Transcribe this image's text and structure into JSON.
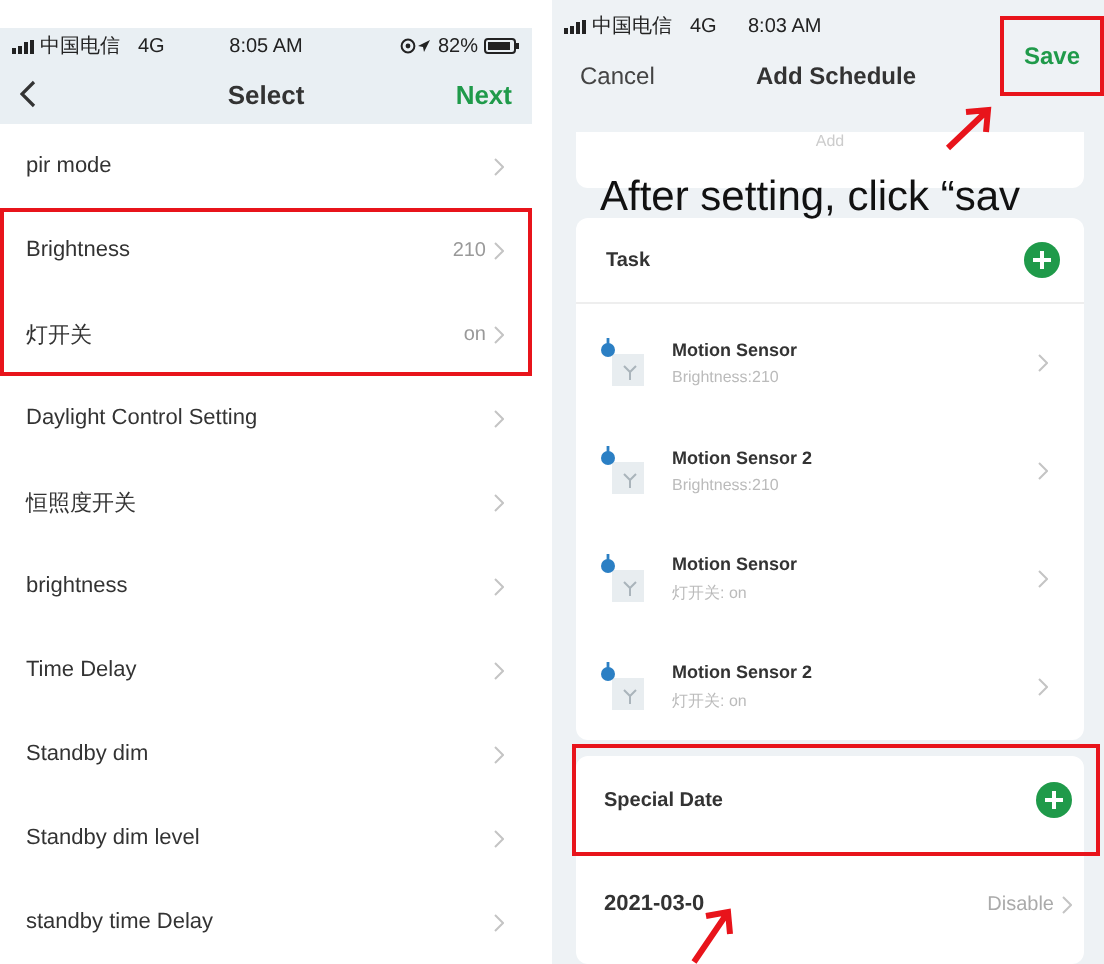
{
  "left_screen": {
    "status_bar": {
      "carrier": "中国电信",
      "network": "4G",
      "time": "8:05 AM",
      "battery": "82%"
    },
    "nav": {
      "title": "Select",
      "action": "Next"
    },
    "items": [
      {
        "label": "pir mode",
        "highlighted": false
      },
      {
        "label": "Brightness",
        "value": "210",
        "highlighted": true
      },
      {
        "label": "灯开关",
        "value": "on",
        "highlighted": true
      },
      {
        "label": "Daylight Control Setting",
        "highlighted": false
      },
      {
        "label": "恒照度开关",
        "highlighted": false
      },
      {
        "label": "brightness",
        "highlighted": false
      },
      {
        "label": "Time Delay",
        "highlighted": false
      },
      {
        "label": "Standby dim",
        "highlighted": false
      },
      {
        "label": "Standby dim level",
        "highlighted": false
      },
      {
        "label": "standby time Delay",
        "highlighted": false
      }
    ]
  },
  "right_screen": {
    "status_bar": {
      "carrier": "中国电信",
      "network": "4G",
      "time": "8:03 AM"
    },
    "nav": {
      "cancel": "Cancel",
      "title": "Add Schedule",
      "action": "Save",
      "action_highlighted": true
    },
    "top_card": {
      "label": "Add"
    },
    "caption": "After setting, click “sav",
    "task": {
      "title": "Task",
      "items": [
        {
          "name": "Motion Sensor",
          "detail": "Brightness:210"
        },
        {
          "name": "Motion Sensor 2",
          "detail": "Brightness:210"
        },
        {
          "name": "Motion Sensor",
          "detail": "灯开关: on"
        },
        {
          "name": "Motion Sensor 2",
          "detail": "灯开关: on"
        }
      ]
    },
    "special_date": {
      "title": "Special Date",
      "highlighted": true,
      "date": "2021-03-0",
      "status": "Disable"
    }
  }
}
